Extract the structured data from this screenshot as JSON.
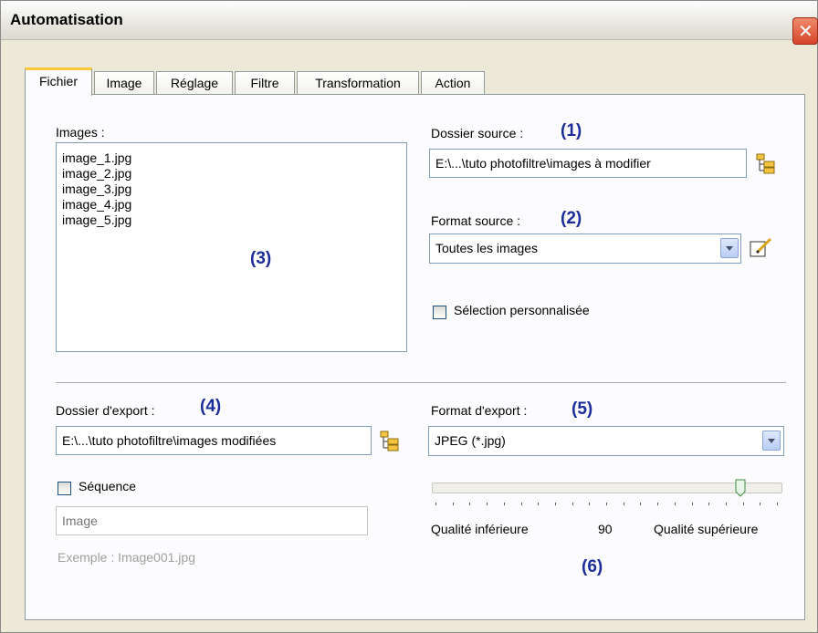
{
  "window": {
    "title": "Automatisation"
  },
  "tabs": [
    {
      "label": "Fichier",
      "active": true
    },
    {
      "label": "Image",
      "active": false
    },
    {
      "label": "Réglage",
      "active": false
    },
    {
      "label": "Filtre",
      "active": false
    },
    {
      "label": "Transformation",
      "active": false
    },
    {
      "label": "Action",
      "active": false
    }
  ],
  "images": {
    "label": "Images :",
    "items": [
      "image_1.jpg",
      "image_2.jpg",
      "image_3.jpg",
      "image_4.jpg",
      "image_5.jpg"
    ],
    "marker": "(3)"
  },
  "source": {
    "folder_label": "Dossier source :",
    "folder_marker": "(1)",
    "folder_value": "E:\\...\\tuto photofiltre\\images à modifier",
    "format_label": "Format source :",
    "format_marker": "(2)",
    "format_value": "Toutes les images",
    "custom_selection_label": "Sélection personnalisée",
    "custom_selection_checked": false
  },
  "export": {
    "folder_label": "Dossier d'export :",
    "folder_marker": "(4)",
    "folder_value": "E:\\...\\tuto photofiltre\\images modifiées",
    "sequence_label": "Séquence",
    "sequence_checked": false,
    "sequence_placeholder": "Image",
    "example_text": "Exemple : Image001.jpg",
    "format_label": "Format d'export :",
    "format_marker": "(5)",
    "format_value": "JPEG (*.jpg)"
  },
  "quality": {
    "low_label": "Qualité inférieure",
    "value": "90",
    "high_label": "Qualité supérieure",
    "marker": "(6)",
    "level": 90
  },
  "colors": {
    "marker": "#1c2d9a",
    "dialog_bg": "#ece9d8",
    "tab_highlight": "#ffc83c",
    "close_button": "#d6452a"
  }
}
